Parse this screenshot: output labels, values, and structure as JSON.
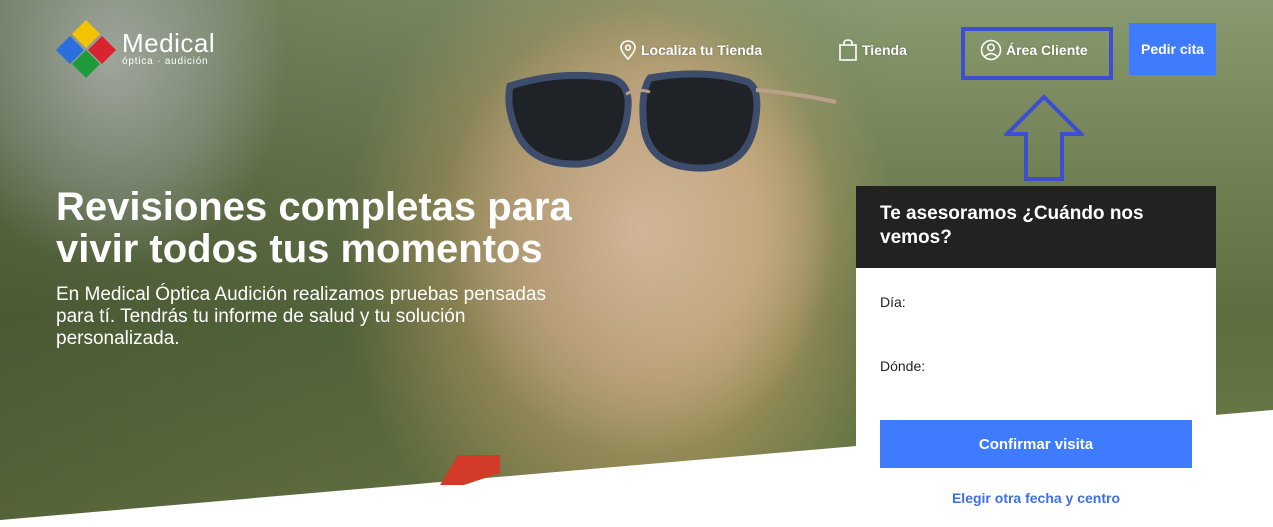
{
  "brand": {
    "name": "Medical",
    "tagline": "óptica · audición",
    "logo_colors": [
      "#f5c400",
      "#2a6fdb",
      "#d9232e",
      "#1e9a3c"
    ]
  },
  "nav": {
    "items": [
      {
        "label": "Localiza tu Tienda",
        "icon": "map-pin-icon"
      },
      {
        "label": "Tienda",
        "icon": "shopping-bag-icon"
      },
      {
        "label": "Área Cliente",
        "icon": "user-circle-icon"
      }
    ],
    "cta_label": "Pedir cita"
  },
  "hero": {
    "title": "Revisiones completas para vivir todos tus momentos",
    "subtitle": "En Medical Óptica Audición realizamos pruebas pensadas para tí. Tendrás tu informe de salud y tu solución personalizada."
  },
  "booking": {
    "title": "Te asesoramos ¿Cuándo nos vemos?",
    "day_label": "Día:",
    "place_label": "Dónde:",
    "confirm_label": "Confirmar visita",
    "other_label": "Elegir otra fecha y centro"
  },
  "colors": {
    "accent": "#3f7bff",
    "highlight": "#3b4fd0",
    "card_header": "#222222",
    "link": "#3f6fe0"
  }
}
